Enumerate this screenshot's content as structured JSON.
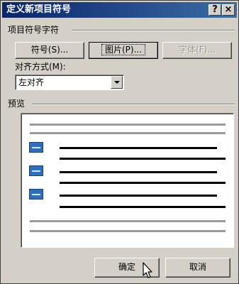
{
  "window": {
    "title": "定义新项目符号",
    "help_label": "?",
    "close_label": "×"
  },
  "bullet_char_group": {
    "label": "项目符号字符",
    "symbol_button": "符号(S)...",
    "picture_button": "图片(P)...",
    "font_button": "字体(F)..."
  },
  "alignment": {
    "label": "对齐方式(M):",
    "selected": "左对齐"
  },
  "preview": {
    "label": "预览",
    "bullet_count": 3
  },
  "footer": {
    "ok_label": "确定",
    "cancel_label": "取消"
  },
  "icons": {
    "dropdown": "chevron-down-icon",
    "bullet": "picture-bullet-icon",
    "pointer": "mouse-pointer-icon"
  },
  "colors": {
    "titlebar": "#0a246a",
    "dialog_bg": "#d4d0c8",
    "bullet": "#2c6ec0"
  }
}
